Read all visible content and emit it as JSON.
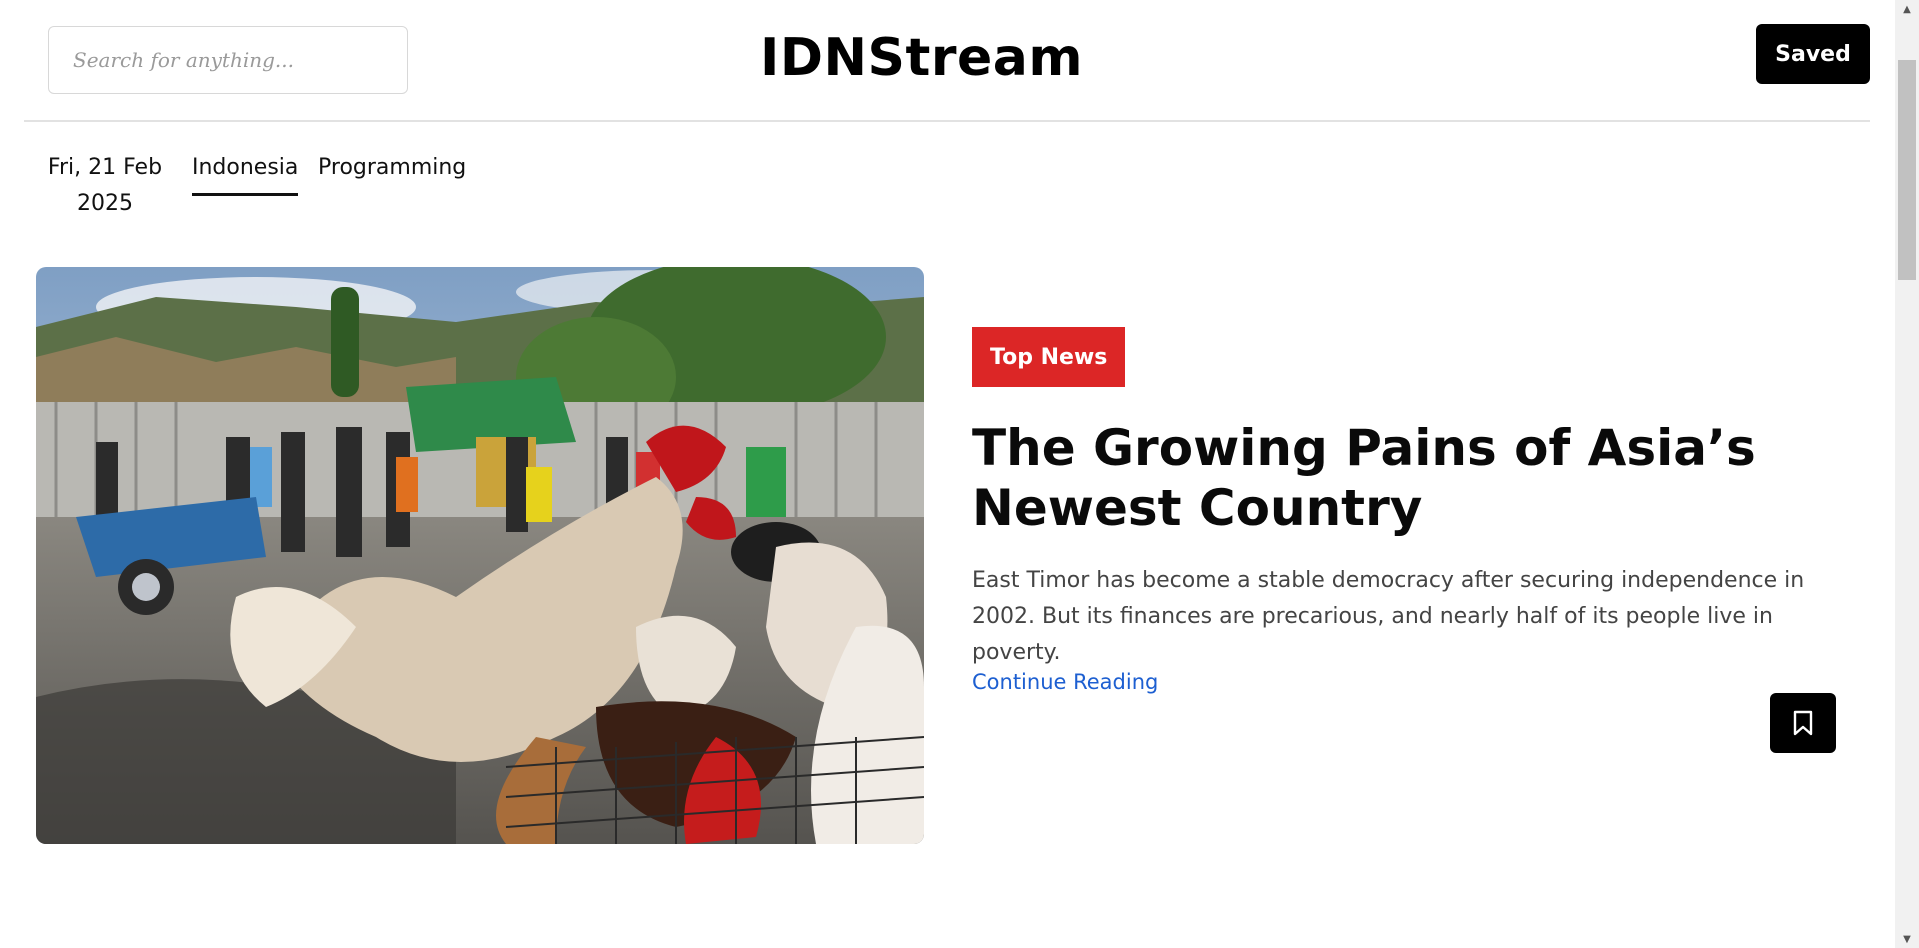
{
  "header": {
    "search_placeholder": "Search for anything...",
    "brand": "IDNStream",
    "saved_label": "Saved"
  },
  "nav": {
    "date": "Fri, 21 Feb 2025",
    "tabs": [
      {
        "label": "Indonesia",
        "active": true
      },
      {
        "label": "Programming",
        "active": false
      }
    ]
  },
  "article": {
    "badge": "Top News",
    "title": "The Growing Pains of Asia’s Newest Country",
    "summary": "East Timor has become a stable democracy after securing independence in 2002. But its finances are precarious, and nearly half of its people live in poverty.",
    "cta": "Continue Reading",
    "bookmark_icon": "bookmark-icon"
  },
  "colors": {
    "badge": "#dc2626",
    "link": "#1d5fd1",
    "button": "#000000"
  }
}
